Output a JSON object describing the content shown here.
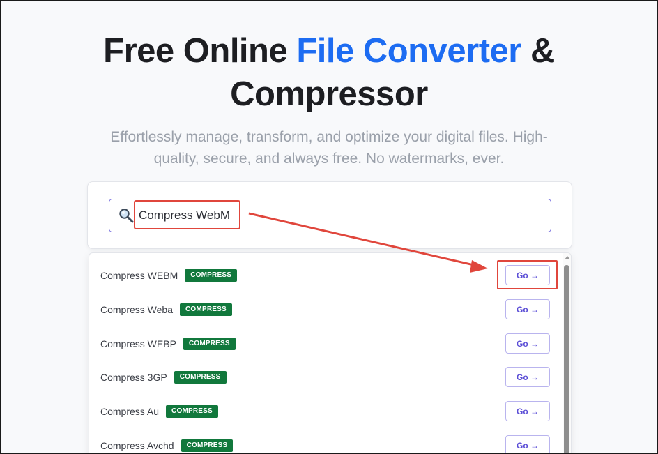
{
  "hero": {
    "title_part1": "Free Online ",
    "title_accent": "File Converter",
    "title_part2": " &",
    "title_line2": "Compressor",
    "subtitle": "Effortlessly manage, transform, and optimize your digital files. High-quality, secure, and always free. No watermarks, ever."
  },
  "search": {
    "value": "Compress WebM",
    "icon": "magnifier-icon"
  },
  "results": [
    {
      "label": "Compress WEBM",
      "badge": "COMPRESS",
      "action": "Go →"
    },
    {
      "label": "Compress Weba",
      "badge": "COMPRESS",
      "action": "Go →"
    },
    {
      "label": "Compress WEBP",
      "badge": "COMPRESS",
      "action": "Go →"
    },
    {
      "label": "Compress 3GP",
      "badge": "COMPRESS",
      "action": "Go →"
    },
    {
      "label": "Compress Au",
      "badge": "COMPRESS",
      "action": "Go →"
    },
    {
      "label": "Compress Avchd",
      "badge": "COMPRESS",
      "action": "Go →"
    }
  ],
  "colors": {
    "accent": "#1d6cf2",
    "badge": "#11783c",
    "annotation": "#e0463c",
    "focus": "#7b73e0"
  }
}
